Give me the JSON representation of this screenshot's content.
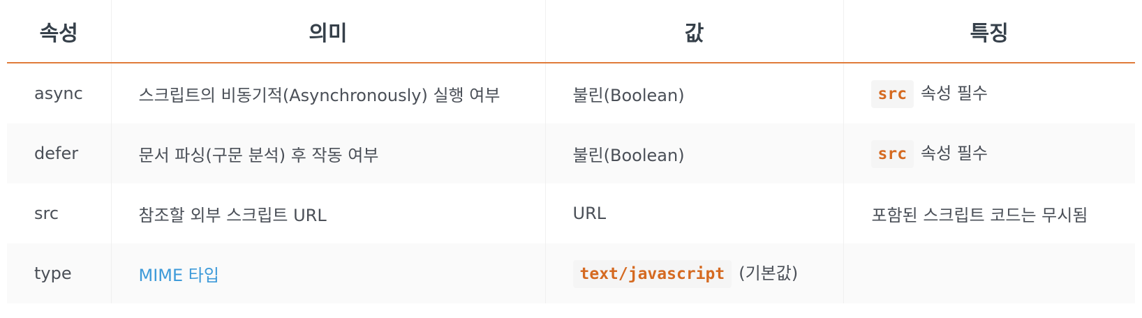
{
  "table": {
    "headers": [
      "속성",
      "의미",
      "값",
      "특징"
    ],
    "rows": [
      {
        "attr": "async",
        "meaning": "스크립트의 비동기적(Asynchronously) 실행 여부",
        "value": "불린(Boolean)",
        "feature_code": "src",
        "feature_text": "속성 필수"
      },
      {
        "attr": "defer",
        "meaning": "문서 파싱(구문 분석) 후 작동 여부",
        "value": "불린(Boolean)",
        "feature_code": "src",
        "feature_text": "속성 필수"
      },
      {
        "attr": "src",
        "meaning": "참조할 외부 스크립트 URL",
        "value": "URL",
        "feature_text": "포함된 스크립트 코드는 무시됨"
      },
      {
        "attr": "type",
        "meaning_link": "MIME 타입",
        "value_code": "text/javascript",
        "value_text": "(기본값)",
        "feature_text": ""
      }
    ]
  },
  "colors": {
    "header_rule": "#e07b39",
    "code_text": "#d56a21",
    "code_bg": "#f5f5f5",
    "link": "#3d9ad9",
    "stripe": "#fafafa"
  }
}
